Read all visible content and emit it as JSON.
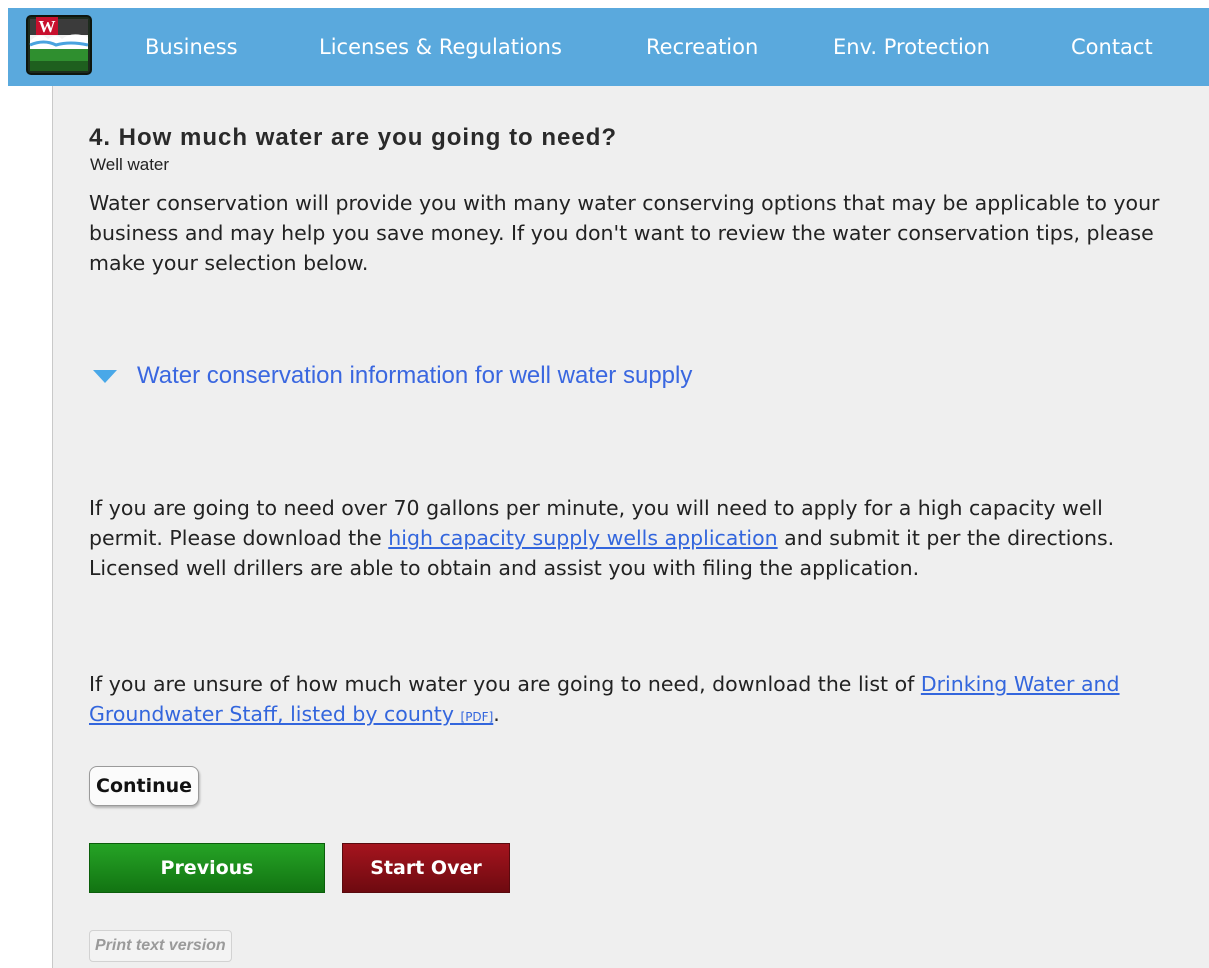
{
  "nav": {
    "items": [
      {
        "label": "Business"
      },
      {
        "label": "Licenses & Regulations"
      },
      {
        "label": "Recreation"
      },
      {
        "label": "Env. Protection"
      },
      {
        "label": "Contact"
      }
    ]
  },
  "logo": {
    "name": "dnr-water-logo-icon",
    "letter": "W"
  },
  "colors": {
    "header": "#5aa9dd",
    "content_bg": "#efefef",
    "link": "#3366dd",
    "previous": "#1e8e1e",
    "start_over": "#8b0f16"
  },
  "main": {
    "title": "4. How much water are you going to need?",
    "subtitle": "Well water",
    "intro": "Water conservation will provide you with many water conserving options that may be applicable to your business and may help you save money. If you don't want to review the water conservation tips, please make your selection below.",
    "disclosure": {
      "icon": "triangle-down-icon",
      "label": "Water conservation information for well water supply"
    },
    "para2": {
      "before": "If you are going to need over 70 gallons per minute, you will need to apply for a high capacity well permit. Please download the ",
      "link": "high capacity supply wells application",
      "after": " and submit it per the directions. Licensed well drillers are able to obtain and assist you with filing the application."
    },
    "para3": {
      "before": "If you are unsure of how much water you are going to need, download the list of ",
      "link": "Drinking Water and Groundwater Staff, listed by county",
      "pdf": "[PDF]",
      "after": "."
    },
    "continue_label": "Continue",
    "previous_label": "Previous",
    "start_over_label": "Start Over",
    "print_label": "Print text version"
  }
}
